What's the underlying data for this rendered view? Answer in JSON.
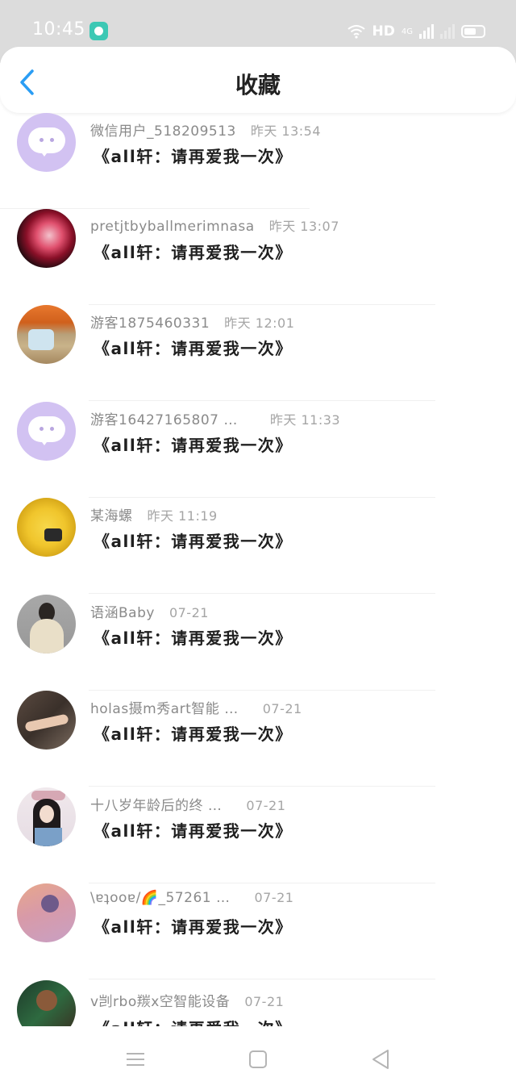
{
  "status_bar": {
    "time": "10:45",
    "hd_label": "HD",
    "network_label": "4G"
  },
  "header": {
    "title": "收藏",
    "back_icon": "chevron-left-icon"
  },
  "colors": {
    "accent": "#2a9df4",
    "status_bar_bg": "#dcdcdc",
    "avatar_purple": "#d2c2f2"
  },
  "items": [
    {
      "user": "微信用户_518209513",
      "time": "昨天 13:54",
      "title": "《all轩：请再爱我一次》",
      "avatar": "chat-bubble-avatar"
    },
    {
      "user": "pretjtbyballmerimnasa",
      "time": "昨天 13:07",
      "title": "《all轩：请再爱我一次》",
      "avatar": "rose-avatar"
    },
    {
      "user": "游客1875460331",
      "time": "昨天 12:01",
      "title": "《all轩：请再爱我一次》",
      "avatar": "cake-avatar"
    },
    {
      "user": "游客16427165807 …",
      "time": "昨天 11:33",
      "title": "《all轩：请再爱我一次》",
      "avatar": "chat-bubble-avatar"
    },
    {
      "user": "某海螺",
      "time": "昨天 11:19",
      "title": "《all轩：请再爱我一次》",
      "avatar": "yellow-plush-avatar"
    },
    {
      "user": "语涵Baby",
      "time": "07-21",
      "title": "《all轩：请再爱我一次》",
      "avatar": "girl-scarf-avatar"
    },
    {
      "user": "holas摄m秀art智能 …",
      "time": "07-21",
      "title": "《all轩：请再爱我一次》",
      "avatar": "hands-art-avatar"
    },
    {
      "user": "十八岁年龄后的终 …",
      "time": "07-21",
      "title": "《all轩：请再爱我一次》",
      "avatar": "girl-hat-avatar"
    },
    {
      "user": "\\ɐʇooɐ/🌈_57261 …",
      "time": "07-21",
      "title": "《all轩：请再爱我一次》",
      "avatar": "pink-art-avatar"
    },
    {
      "user": "v剀rbo羰x空智能设备",
      "time": "07-21",
      "title": "《all轩：请再爱我一次》",
      "avatar": "green-art-avatar"
    }
  ],
  "nav_bar": {
    "menu_icon": "menu-icon",
    "home_icon": "square-home-icon",
    "back_icon": "triangle-back-icon"
  }
}
